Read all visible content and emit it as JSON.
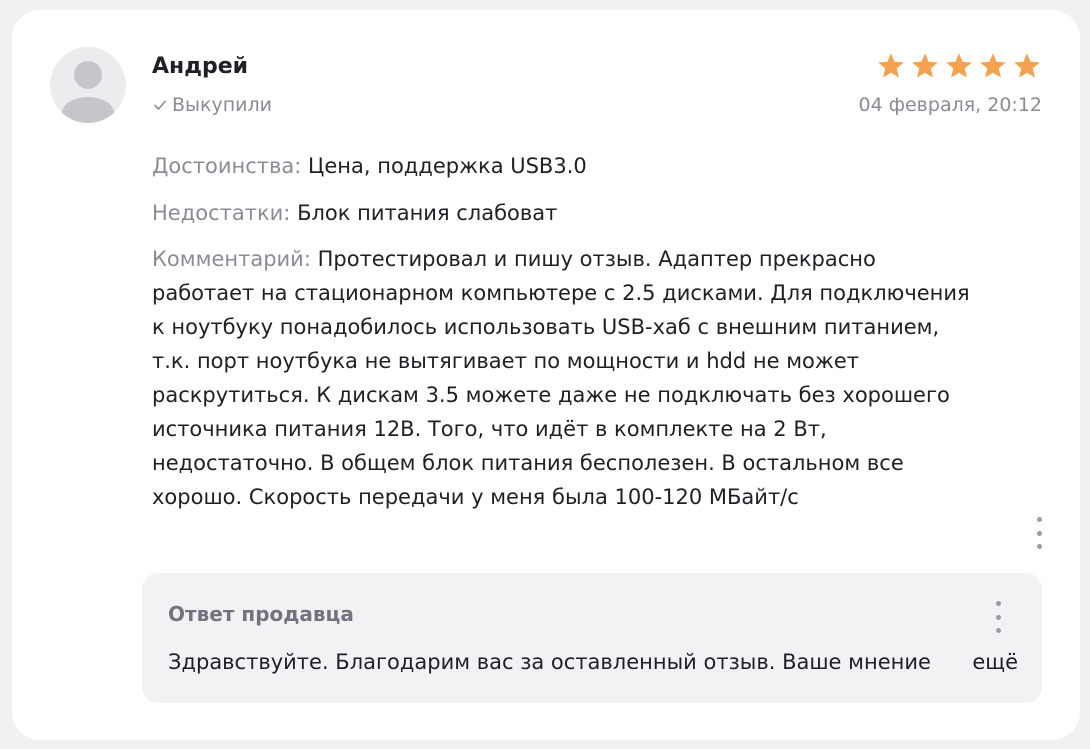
{
  "review": {
    "author": "Андрей",
    "verified_label": "Выкупили",
    "rating": 5,
    "date": "04 февраля, 20:12",
    "pros_label": "Достоинства:",
    "pros_text": "Цена, поддержка USB3.0",
    "cons_label": "Недостатки:",
    "cons_text": "Блок питания слабоват",
    "comment_label": "Комментарий:",
    "comment_text": "Протестировал и пишу отзыв. Адаптер прекрасно работает на стационарном компьютере с 2.5 дисками. Для подключения к ноутбуку понадобилось использовать USB-хаб с внешним питанием, т.к. порт ноутбука не вытягивает по мощности и hdd не может раскрутиться. К дискам 3.5 можете даже не подключать без хорошего источника питания 12В. Того, что идёт в комплекте на 2 Вт, недостаточно. В общем блок питания бесполезен. В остальном все хорошо. Скорость передачи у меня была 100-120 МБайт/с"
  },
  "seller_reply": {
    "title": "Ответ продавца",
    "text": "Здравствуйте. Благодарим вас за оставленный отзыв. Ваше мнение",
    "more_label": "ещё"
  },
  "icons": {
    "avatar": "user-avatar-icon",
    "verified": "check-icon",
    "star": "star-icon",
    "more": "more-vertical-icon"
  },
  "colors": {
    "star": "#f2a250",
    "muted_text": "#8b8b95",
    "reply_bg": "#f2f2f5"
  }
}
